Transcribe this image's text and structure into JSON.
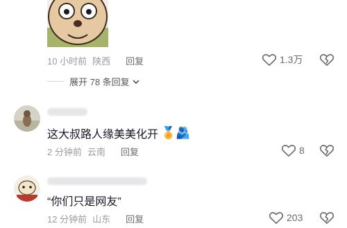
{
  "thread_top": {
    "meta_time": "10 小时前",
    "meta_location": "陕西",
    "reply_label": "回复",
    "like_count": "1.3万"
  },
  "expand": {
    "label": "展开 78 条回复"
  },
  "comments": [
    {
      "text": "这大叔路人缘美美化开",
      "emojis": "🏅🫂",
      "meta_time": "2 分钟前",
      "meta_location": "云南",
      "reply_label": "回复",
      "like_count": "8"
    },
    {
      "text": "“你们只是网友”",
      "meta_time": "12 分钟前",
      "meta_location": "山东",
      "reply_label": "回复",
      "like_count": "203"
    }
  ],
  "icons": {
    "like": "heart-icon",
    "dislike": "dislike-heart-icon",
    "expand": "chevron-down-icon"
  },
  "colors": {
    "text_primary": "#161823",
    "text_secondary": "#9a9ba0",
    "reply_text": "#6b6c72"
  }
}
